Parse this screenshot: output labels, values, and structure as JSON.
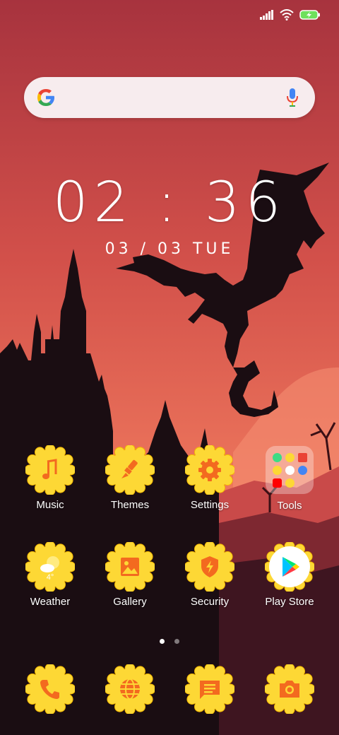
{
  "status_bar": {
    "signal_icon": "signal-icon",
    "wifi_icon": "wifi-icon",
    "battery_icon": "battery-charging-icon"
  },
  "search": {
    "logo": "google-g-icon",
    "mic": "mic-icon"
  },
  "clock": {
    "time": "02 : 36",
    "date": "03 / 03  TUE"
  },
  "apps_row1": [
    {
      "label": "Music",
      "icon": "music-note-icon"
    },
    {
      "label": "Themes",
      "icon": "paintbrush-icon"
    },
    {
      "label": "Settings",
      "icon": "gear-icon"
    },
    {
      "label": "Tools",
      "icon": "folder-icon"
    }
  ],
  "apps_row2": [
    {
      "label": "Weather",
      "icon": "weather-icon",
      "temp": "4°"
    },
    {
      "label": "Gallery",
      "icon": "image-icon"
    },
    {
      "label": "Security",
      "icon": "shield-bolt-icon"
    },
    {
      "label": "Play Store",
      "icon": "play-store-icon"
    }
  ],
  "page_indicator": {
    "pages": 2,
    "active": 1
  },
  "dock": [
    {
      "icon": "phone-icon"
    },
    {
      "icon": "globe-icon"
    },
    {
      "icon": "message-icon"
    },
    {
      "icon": "camera-icon"
    }
  ],
  "colors": {
    "icon_yellow": "#fdd835",
    "icon_orange": "#f36a1f",
    "sky_top": "#a7333e",
    "sky_bottom": "#f07a5e"
  }
}
